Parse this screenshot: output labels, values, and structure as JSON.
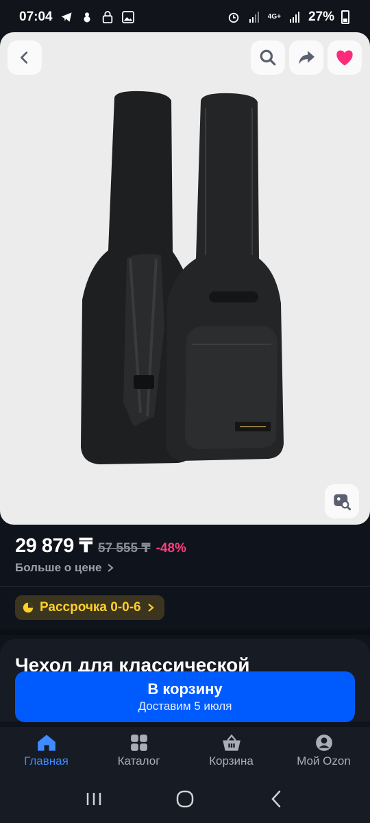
{
  "status_bar": {
    "time": "07:04",
    "network": "4G+",
    "battery": "27%"
  },
  "product": {
    "price": "29 879 ₸",
    "old_price": "57 555 ₸",
    "discount": "-48%",
    "more_price_label": "Больше о цене",
    "installment_label": "Рассрочка 0-0-6",
    "title_peek": "Чехол для классической"
  },
  "cart_button": {
    "title": "В корзину",
    "subtitle": "Доставим 5 июля"
  },
  "bottom_nav": [
    {
      "label": "Главная",
      "icon": "home-icon",
      "active": true
    },
    {
      "label": "Каталог",
      "icon": "grid-icon",
      "active": false
    },
    {
      "label": "Корзина",
      "icon": "basket-icon",
      "active": false
    },
    {
      "label": "Мой Ozon",
      "icon": "profile-icon",
      "active": false
    }
  ],
  "colors": {
    "accent": "#005bff",
    "discount": "#ff3d7f",
    "installment": "#ffd028",
    "favorite": "#ff2a7a",
    "nav_active": "#3f8bff"
  }
}
